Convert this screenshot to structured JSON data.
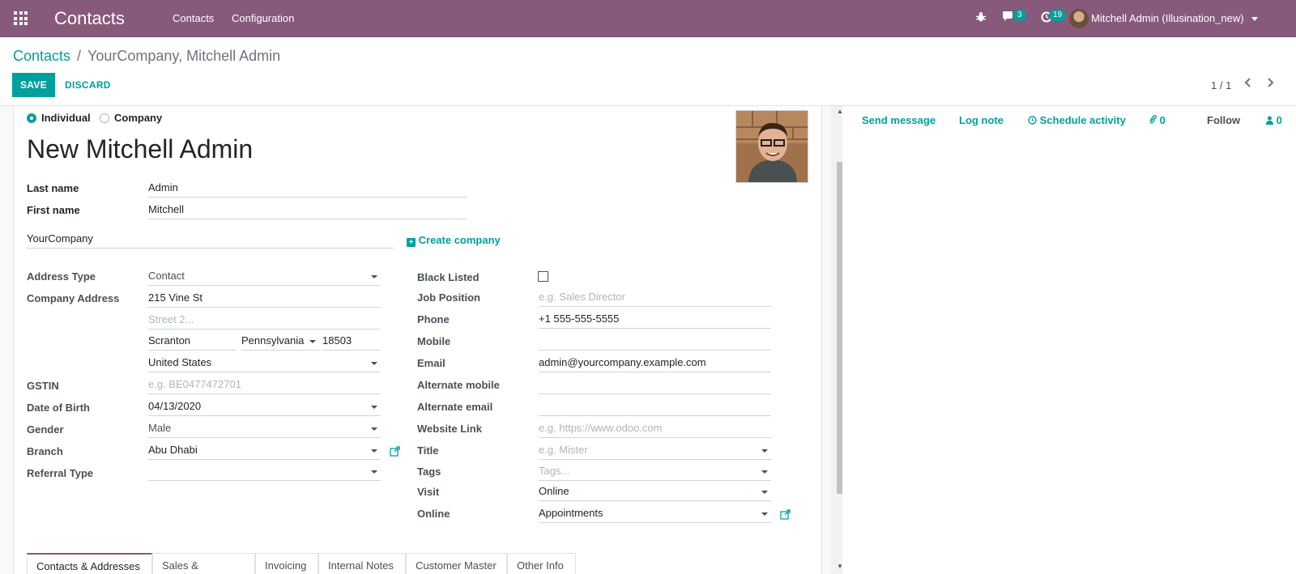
{
  "navbar": {
    "brand": "Contacts",
    "menu": [
      "Contacts",
      "Configuration"
    ],
    "messages_count": "3",
    "activities_count": "19",
    "user": "Mitchell Admin (Illusination_new)"
  },
  "breadcrumb": {
    "parent": "Contacts",
    "separator": "/",
    "current": "YourCompany, Mitchell Admin"
  },
  "actions": {
    "save": "SAVE",
    "discard": "DISCARD"
  },
  "pager": {
    "value": "1 / 1",
    "prev": "‹",
    "next": "›"
  },
  "form": {
    "type_options": {
      "individual": "Individual",
      "company": "Company",
      "selected": "Individual"
    },
    "title": "New  Mitchell Admin",
    "last_name": {
      "label": "Last name",
      "value": "Admin"
    },
    "first_name": {
      "label": "First name",
      "value": "Mitchell"
    },
    "company": {
      "value": "YourCompany",
      "create_label": "Create company"
    },
    "address_type": {
      "label": "Address Type",
      "value": "Contact"
    },
    "company_address": {
      "label": "Company Address",
      "street": "215 Vine St",
      "street2_placeholder": "Street 2...",
      "city": "Scranton",
      "state": "Pennsylvania",
      "zip": "18503",
      "country": "United States"
    },
    "gstin": {
      "label": "GSTIN",
      "placeholder": "e.g. BE0477472701"
    },
    "dob": {
      "label": "Date of Birth",
      "value": "04/13/2020"
    },
    "gender": {
      "label": "Gender",
      "value": "Male"
    },
    "branch": {
      "label": "Branch",
      "value": "Abu Dhabi"
    },
    "referral_type": {
      "label": "Referral Type",
      "value": ""
    },
    "black_listed": {
      "label": "Black Listed",
      "checked": false
    },
    "job_position": {
      "label": "Job Position",
      "placeholder": "e.g. Sales Director"
    },
    "phone": {
      "label": "Phone",
      "value": "+1 555-555-5555"
    },
    "mobile": {
      "label": "Mobile",
      "value": ""
    },
    "email": {
      "label": "Email",
      "value": "admin@yourcompany.example.com"
    },
    "alt_mobile": {
      "label": "Alternate mobile",
      "value": ""
    },
    "alt_email": {
      "label": "Alternate email",
      "value": ""
    },
    "website": {
      "label": "Website Link",
      "placeholder": "e.g. https://www.odoo.com"
    },
    "title_field": {
      "label": "Title",
      "placeholder": "e.g. Mister"
    },
    "tags": {
      "label": "Tags",
      "placeholder": "Tags..."
    },
    "visit": {
      "label": "Visit",
      "value": "Online"
    },
    "online": {
      "label": "Online",
      "value": "Appointments"
    }
  },
  "tabs": [
    "Contacts & Addresses",
    "Sales & Purchase",
    "Invoicing",
    "Internal Notes",
    "Customer Master",
    "Other Info"
  ],
  "chatter": {
    "send_message": "Send message",
    "log_note": "Log note",
    "schedule_activity": "Schedule activity",
    "attachments": "0",
    "follow": "Follow",
    "followers": "0"
  }
}
